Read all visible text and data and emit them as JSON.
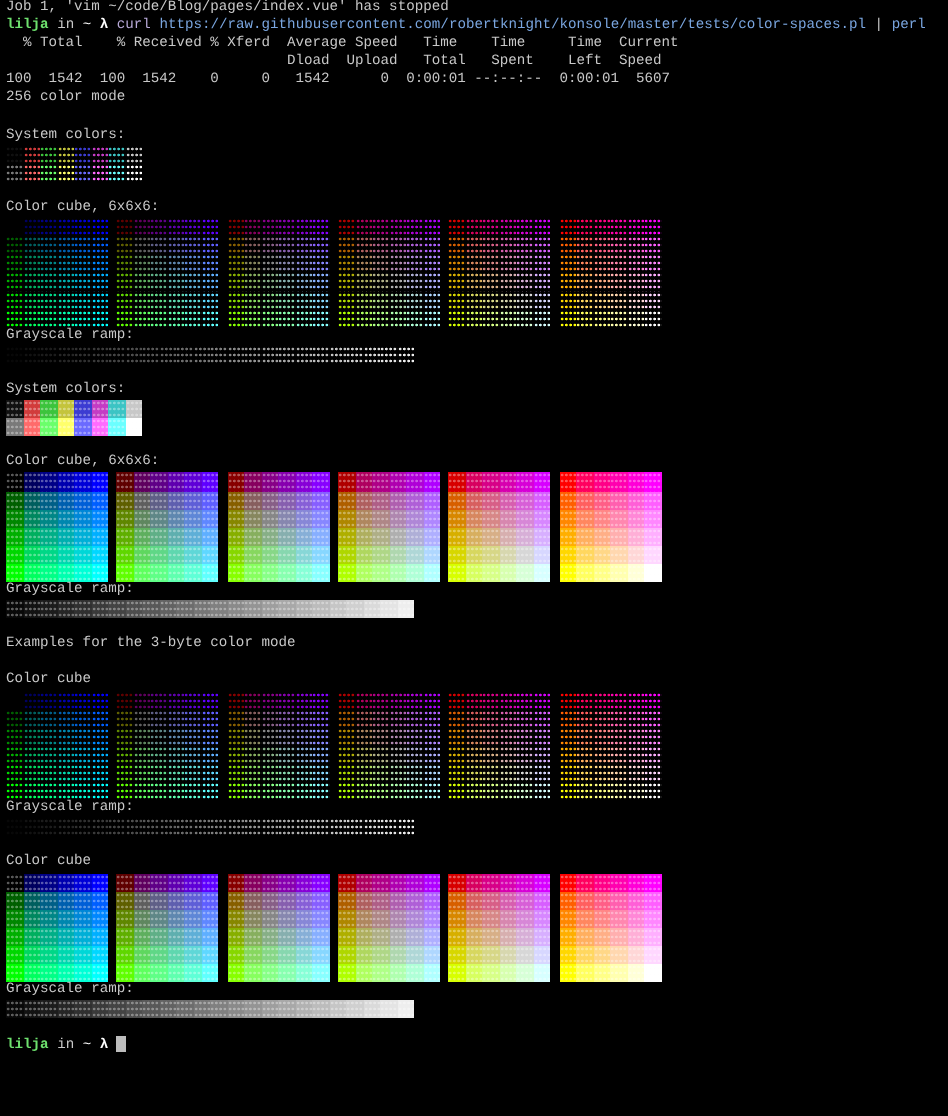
{
  "terminal": {
    "lines": [
      {
        "kind": "text",
        "text": "Job 1, 'vim ~/code/Blog/pages/index.vue' has stopped"
      },
      {
        "kind": "prompt",
        "user": "lilja",
        "preposition": "in",
        "location": "~",
        "symbol": "λ",
        "command": [
          {
            "kind": "program",
            "text": "curl"
          },
          {
            "kind": "argument",
            "text": "https://raw.githubusercontent.com/robertknight/konsole/master/tests/color-spaces.pl"
          },
          {
            "kind": "pipe",
            "text": "|"
          },
          {
            "kind": "argument",
            "text": "perl"
          }
        ]
      },
      {
        "kind": "text",
        "text": "  % Total    % Received % Xferd  Average Speed   Time    Time     Time  Current"
      },
      {
        "kind": "text",
        "text": "                                 Dload  Upload   Total   Spent    Left  Speed"
      },
      {
        "kind": "text",
        "text": "100  1542  100  1542    0     0   1542      0  0:00:01 --:--:--  0:00:01  5607"
      },
      {
        "kind": "text",
        "text": "256 color mode"
      },
      {
        "kind": "blank"
      },
      {
        "kind": "text",
        "text": "System colors:"
      },
      {
        "kind": "system",
        "background": false,
        "bright": false
      },
      {
        "kind": "system",
        "background": false,
        "bright": true
      },
      {
        "kind": "blank"
      },
      {
        "kind": "text",
        "text": "Color cube, 6x6x6:"
      },
      {
        "kind": "cube",
        "background": false
      },
      {
        "kind": "text",
        "text": "Grayscale ramp:"
      },
      {
        "kind": "ramp",
        "background": false
      },
      {
        "kind": "blank"
      },
      {
        "kind": "text",
        "text": "System colors:"
      },
      {
        "kind": "system",
        "background": true,
        "bright": false
      },
      {
        "kind": "system",
        "background": true,
        "bright": true
      },
      {
        "kind": "blank"
      },
      {
        "kind": "text",
        "text": "Color cube, 6x6x6:"
      },
      {
        "kind": "cube",
        "background": true
      },
      {
        "kind": "text",
        "text": "Grayscale ramp:"
      },
      {
        "kind": "ramp",
        "background": true
      },
      {
        "kind": "blank"
      },
      {
        "kind": "text",
        "text": "Examples for the 3-byte color mode"
      },
      {
        "kind": "blank"
      },
      {
        "kind": "text",
        "text": "Color cube"
      },
      {
        "kind": "cube",
        "background": false
      },
      {
        "kind": "text",
        "text": "Grayscale ramp:"
      },
      {
        "kind": "ramp",
        "background": false
      },
      {
        "kind": "blank"
      },
      {
        "kind": "text",
        "text": "Color cube"
      },
      {
        "kind": "cube",
        "background": true
      },
      {
        "kind": "text",
        "text": "Grayscale ramp:"
      },
      {
        "kind": "ramp",
        "background": true
      },
      {
        "kind": "blank"
      },
      {
        "kind": "prompt",
        "user": "lilja",
        "preposition": "in",
        "location": "~",
        "symbol": "λ",
        "cursor": true
      }
    ]
  }
}
